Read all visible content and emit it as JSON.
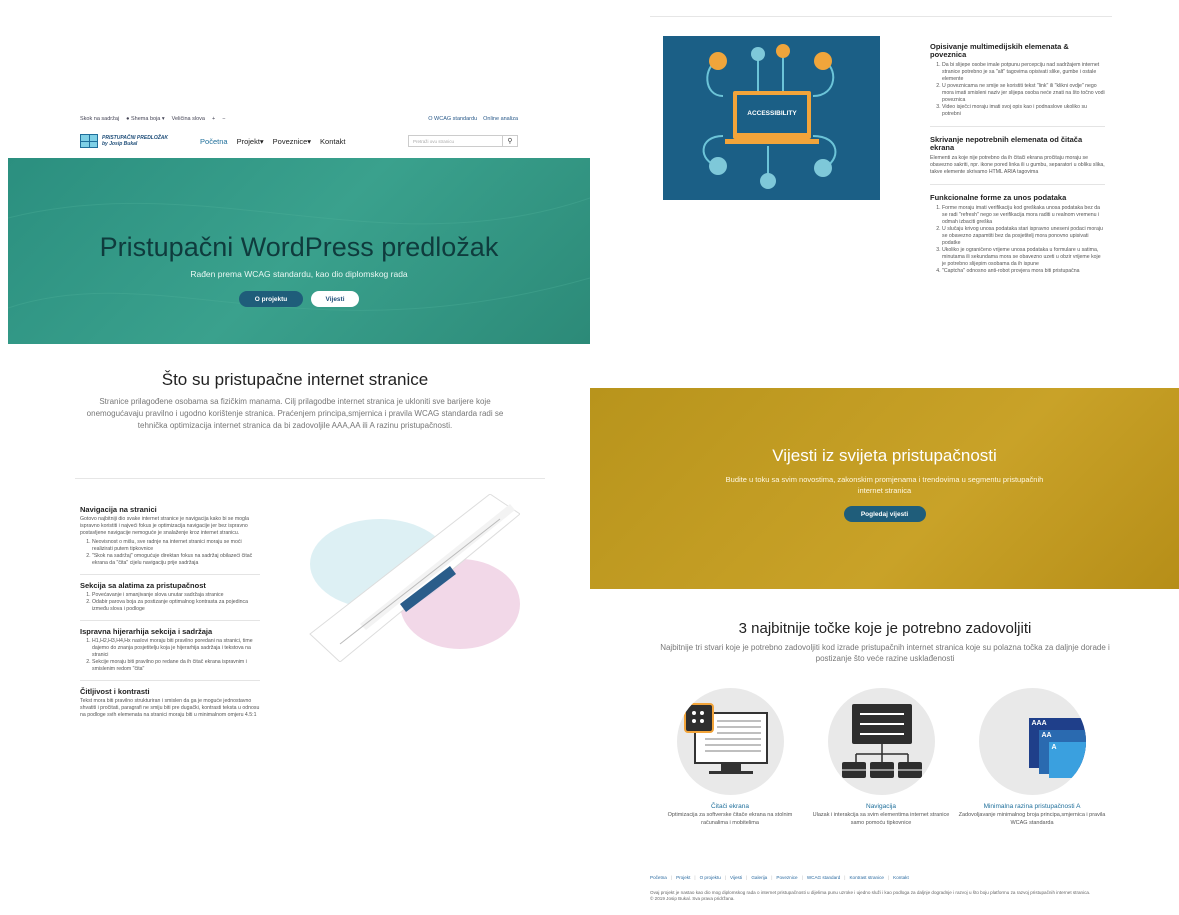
{
  "left": {
    "utility": {
      "skip": "Skok na sadržaj",
      "scheme": "Shema boja",
      "size": "Veličina slova",
      "plus": "+",
      "minus": "−",
      "wcag": "O WCAG standardu",
      "analysis": "Online analiza"
    },
    "logo": {
      "line1": "PRISTUPAČNI PREDLOŽAK",
      "line2": "by Josip Bukal"
    },
    "menu": [
      "Početna",
      "Projekt",
      "Poveznice",
      "Kontakt"
    ],
    "search_placeholder": "Pretraži ovu stranicu",
    "hero": {
      "title": "Pristupačni WordPress predložak",
      "subtitle": "Rađen prema WCAG standardu, kao dio diplomskog rada",
      "btn1": "O projektu",
      "btn2": "Vijesti"
    },
    "intro": {
      "title": "Što su pristupačne internet stranice",
      "text": "Stranice prilagođene osobama sa fizičkim manama. Cilj prilagodbe internet stranica je ukloniti sve barijere koje onemogućavaju pravilno i ugodno korištenje stranica. Praćenjem principa,smjernica i pravila WCAG standarda radi se tehnička optimizacija internet stranica da bi zadovoljile AAA,AA ili A razinu pristupačnosti."
    },
    "features": [
      {
        "title": "Navigacija na stranici",
        "text": "Gotovo najbitniji dio svake internet stranice je navigacija kako bi se mogla ispravno koristiti i najveći fokus je optimizacija navigacije jer bez ispravno postavljene navigacije nemoguće je snalaženje kroz internet stranicu.",
        "items": [
          "Neovisnost o mišu, sve radnje na internet stranici moraju se moći realizirati putem tipkovnice",
          "\"Skok na sadržaj\" omogućuje direktan fokus na sadržaj obilazeći čitač ekrana da \"čita\" cijelu navigaciju prije sadržaja"
        ]
      },
      {
        "title": "Sekcija sa alatima za pristupačnost",
        "text": "",
        "items": [
          "Povećavanje i smanjivanje slova unutar sadržaja stranice",
          "Odabir parova boja za postizanje optimalnog kontrasta za pojedinca između slova i podloge"
        ]
      },
      {
        "title": "Ispravna hijerarhija sekcija i sadržaja",
        "text": "",
        "items": [
          "H1,H2,H3,H4,Hx naslovi moraju biti pravilno poredani na stranici, time dajemo do znanja posjetitelju koja je hijerarhija sadržaja i tekstova na stranici",
          "Sekcije moraju biti pravilno po redane da ih čitač ekrana ispravnim i smislenim redom \"čita\""
        ]
      },
      {
        "title": "Čitljivost i kontrasti",
        "text": "Tekst mora biti pravilno strukturiran i smislen da ga je moguće jednostavno shvatiti i pročitati, paragrafi ne smiju biti pre dugački, kontrasti teksta u odnosu na podloge svih elemenata na stranici moraju biti u minimalnom omjeru 4.5:1",
        "items": []
      }
    ]
  },
  "right": {
    "access_label": "ACCESSIBILITY",
    "blocks": [
      {
        "title": "Opisivanje multimedijskih elemenata & poveznica",
        "text": "",
        "items": [
          "Da bi slijepe osobe imale potpunu percepciju nad sadržajem internet stranice potrebno je sa \"alt\" tagovima opisivati slike, gumbe i ostale elemente",
          "U poveznicama ne smije se koristiti tekst \"link\" ili \"klikni ovdje\" nego mora imati smisleni naziv jer slijepa osoba neće znati na što točno vodi poveznica",
          "Video isječci moraju imati svoj opis kao i podnaslove ukoliko su potrebni"
        ]
      },
      {
        "title": "Skrivanje nepotrebnih elemenata od čitača ekrana",
        "text": "Elementi za koje nije potrebno da ih čitači ekrana pročitaju moraju se obavezno sakriti, npr. ikone pored linka ili u gumbu, separatori u obliku slika, takve elemente skrivamo HTML ARIA tagovima",
        "items": []
      },
      {
        "title": "Funkcionalne forme za unos podataka",
        "text": "",
        "items": [
          "Forme moraju imati verifikaciju kod greškaka unosa podataka bez da se radi \"refresh\" nego se verifikacija mora raditi u realnom vremenu i odmah izbaciti greška",
          "U slučaju krivog unosa podataka stari ispravno uneseni podaci moraju se obavezno zapamtiti bez da posjetitelj mora ponovno upisivati podatke",
          "Ukoliko je ograničeno vrijeme unosa podataka u formulare u satima, minutama ili sekundama mora se obavezno uzeti u obzir vrijeme koje je potrebno slijepim osobama da ih ispune",
          "\"Captcha\" odnosno anti-robot provjera mora biti pristupačna"
        ]
      }
    ],
    "news": {
      "title": "Vijesti iz svijeta pristupačnosti",
      "text": "Budite u toku sa svim novostima, zakonskim promjenama i trendovima u segmentu pristupačnih internet stranica",
      "btn": "Pogledaj vijesti"
    },
    "points": {
      "title": "3 najbitnije točke koje je potrebno zadovoljiti",
      "text": "Najbitnije tri stvari koje je potrebno zadovoljiti kod izrade pristupačnih internet stranica koje su polazna točka za daljnje dorade i postizanje što veće razine usklađenosti",
      "cards": [
        {
          "title": "Čitači ekrana",
          "text": "Optimizacija za softverske čitače ekrana na stolnim računalima i mobitelima"
        },
        {
          "title": "Navigacija",
          "text": "Ulazak i interakcija sa svim elementima internet stranice samo pomoću tipkovnice"
        },
        {
          "title": "Minimalna razina pristupačnosti A",
          "text": "Zadovoljavanje minimalnog broja principa,smjernica i pravila WCAG standarda"
        }
      ],
      "aaa": [
        "AAA",
        "AA",
        "A"
      ]
    },
    "footer": {
      "links": [
        "Početna",
        "Projekt",
        "O projektu",
        "Vijesti",
        "Galerija",
        "Poveznice",
        "WCAG standard",
        "Kontrast stranice",
        "Kontakt"
      ],
      "text": "Ovaj projekt je nastao kao dio mog diplomskog rada o internet pristupačnosti u dijelima punu uzroke i ujedno služi i kao podloga za daljnje dogradnje i razvoj u što boju platformu za razvoj pristupačnih internet stranica.",
      "copy": "© 2019 Josip Bukal. Sva prava pridržana."
    }
  }
}
